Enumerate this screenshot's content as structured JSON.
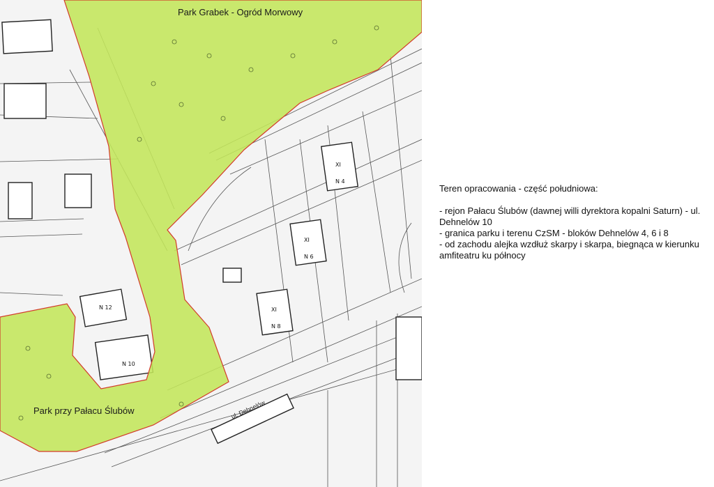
{
  "map": {
    "park_north_label": "Park Grabek - Ogród Morwowy",
    "park_south_label": "Park przy Pałacu Ślubów",
    "street_label": "ul. Dehnelów",
    "building_labels": [
      "XI",
      "XI",
      "XI",
      "N 12",
      "N 10",
      "N 8",
      "N 6",
      "N 4"
    ],
    "park_fill_color": "#c3e65a",
    "park_border_color": "#d33a2a"
  },
  "legend": {
    "title": "Teren opracowania - część południowa:",
    "items": [
      "- rejon Pałacu Ślubów (dawnej willi dyrektora kopalni Saturn) - ul. Dehnelów 10",
      "- granica parku i terenu CzSM - bloków Dehnelów 4, 6 i 8",
      "- od zachodu alejka wzdłuż skarpy i skarpa, biegnąca w kierunku amfiteatru ku północy"
    ]
  }
}
